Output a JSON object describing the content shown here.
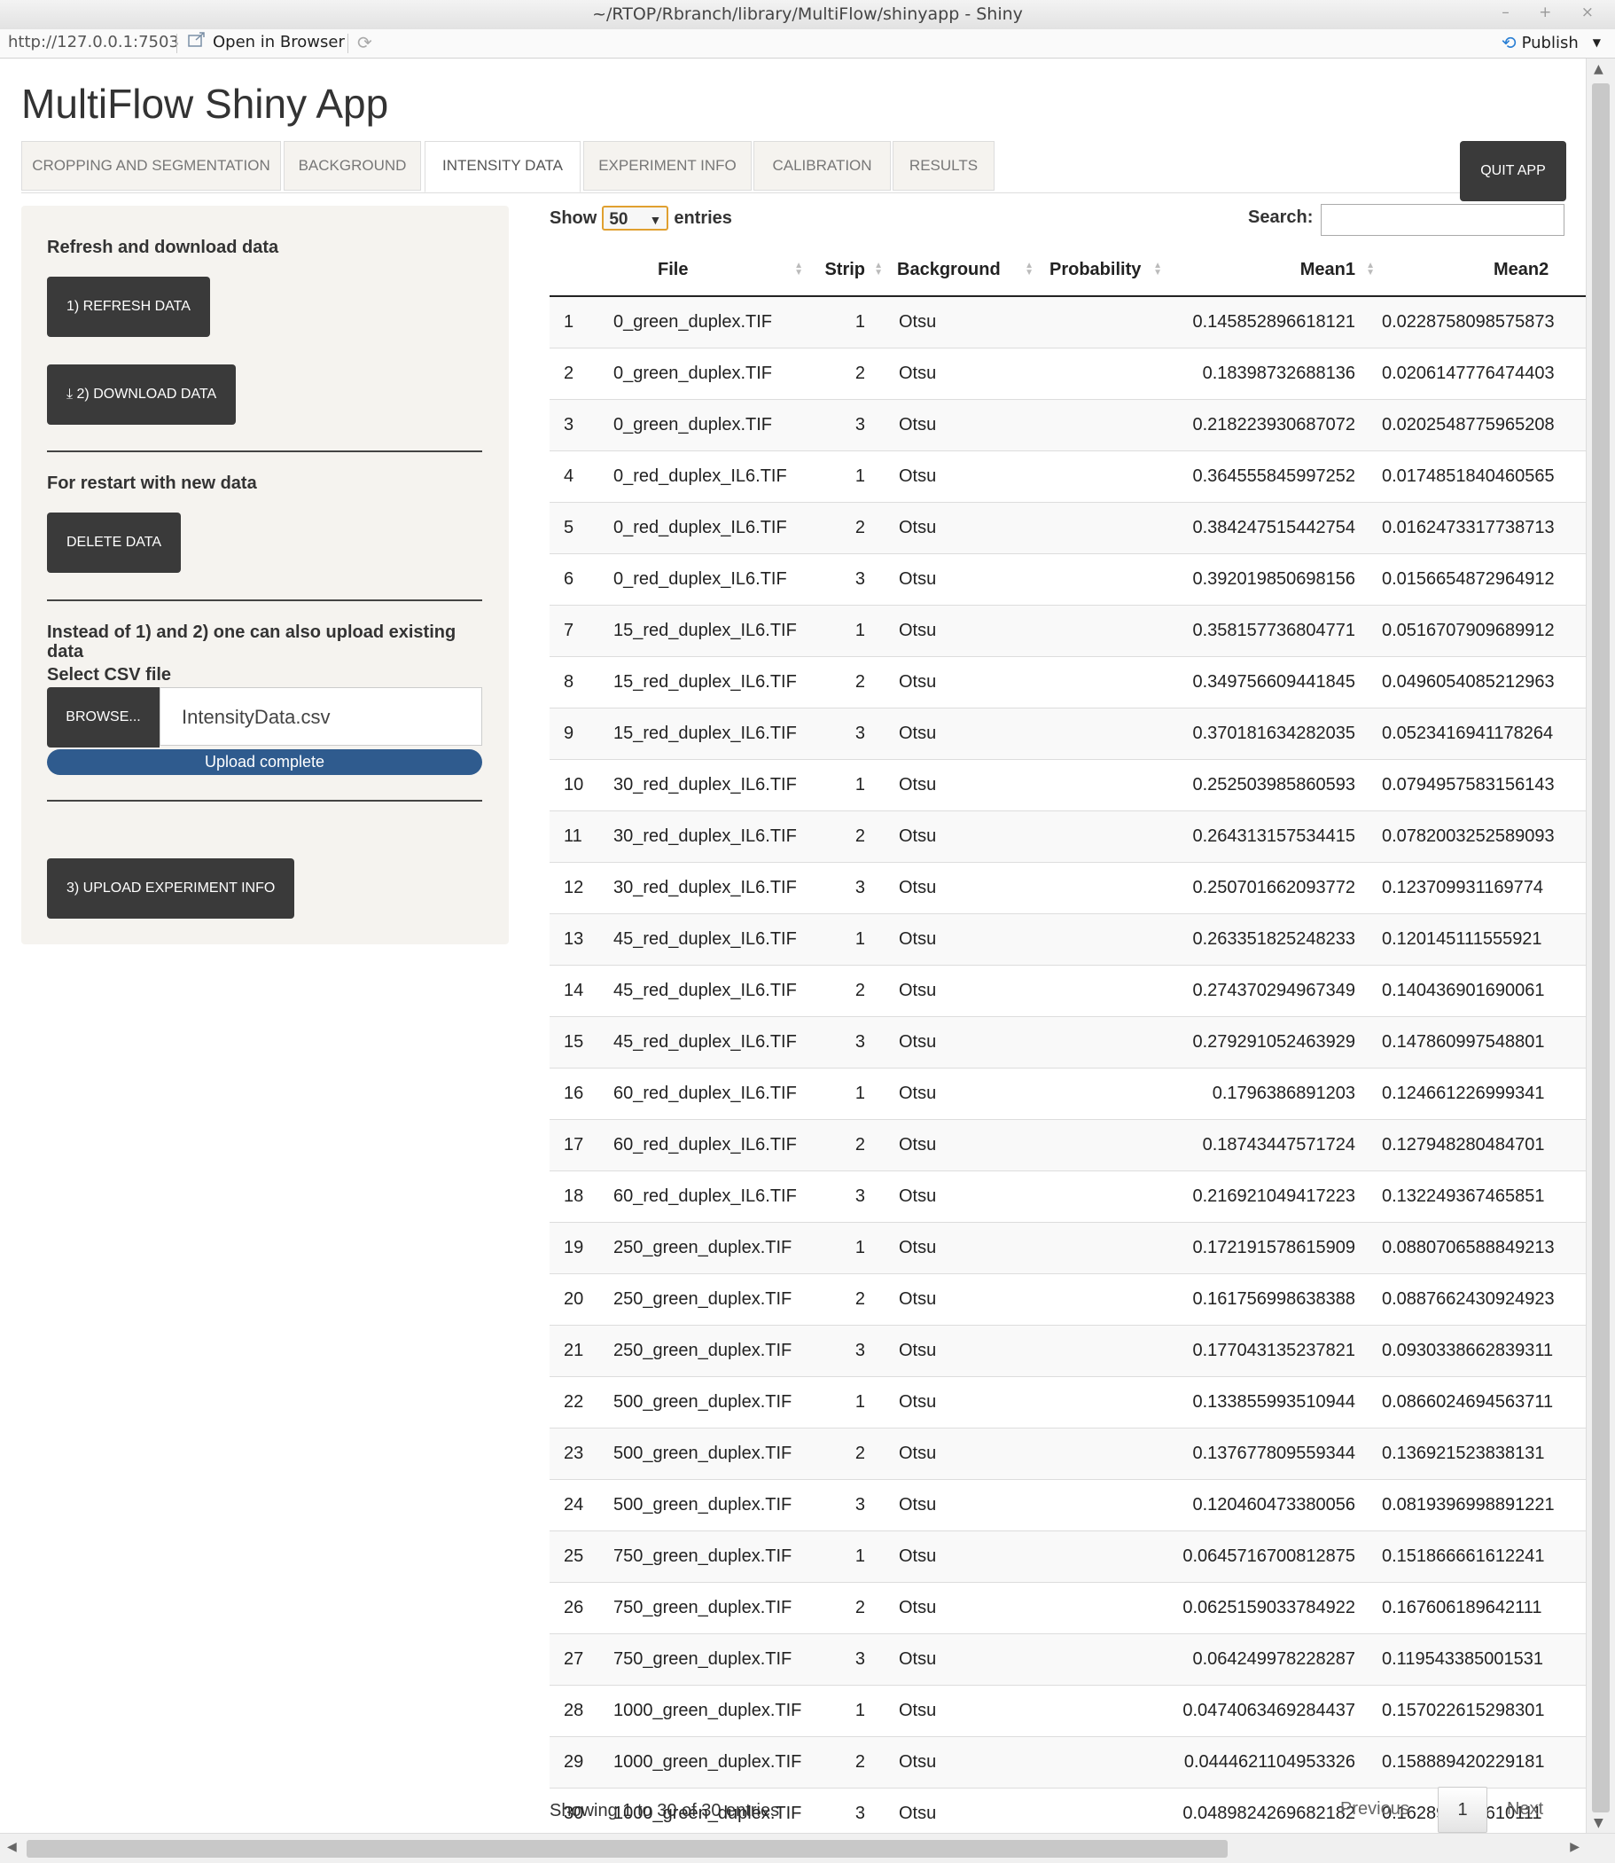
{
  "window": {
    "title": "~/RTOP/Rbranch/library/MultiFlow/shinyapp - Shiny",
    "controls": "– + ×"
  },
  "addressbar": {
    "url": "http://127.0.0.1:7503",
    "open_in_browser": "Open in Browser",
    "publish": "Publish"
  },
  "app": {
    "title": "MultiFlow Shiny App",
    "quit": "QUIT APP"
  },
  "tabs": [
    {
      "label": "CROPPING AND SEGMENTATION"
    },
    {
      "label": "BACKGROUND"
    },
    {
      "label": "INTENSITY DATA"
    },
    {
      "label": "EXPERIMENT INFO"
    },
    {
      "label": "CALIBRATION"
    },
    {
      "label": "RESULTS"
    }
  ],
  "sidebar": {
    "refresh_heading": "Refresh and download data",
    "refresh_button": "1) REFRESH DATA",
    "download_button": "2) DOWNLOAD DATA",
    "restart_heading": "For restart with new data",
    "delete_button": "DELETE DATA",
    "upload_heading": "Instead of 1) and 2) one can also upload existing data",
    "select_label": "Select CSV file",
    "browse_button": "BROWSE...",
    "file_name": "IntensityData.csv",
    "upload_status": "Upload complete",
    "upload_progress": 1.0,
    "experiment_button": "3) UPLOAD EXPERIMENT INFO"
  },
  "datatable": {
    "show_label": "Show",
    "page_length": "50",
    "entries_label": "entries",
    "search_label": "Search:",
    "search_value": "",
    "columns": [
      "",
      "File",
      "Strip",
      "Background",
      "Probability",
      "Mean1",
      "Mean2"
    ],
    "rows": [
      [
        "1",
        "0_green_duplex.TIF",
        "1",
        "Otsu",
        "",
        "0.145852896618121",
        "0.0228758098575873"
      ],
      [
        "2",
        "0_green_duplex.TIF",
        "2",
        "Otsu",
        "",
        "0.18398732688136",
        "0.0206147776474403"
      ],
      [
        "3",
        "0_green_duplex.TIF",
        "3",
        "Otsu",
        "",
        "0.218223930687072",
        "0.0202548775965208"
      ],
      [
        "4",
        "0_red_duplex_IL6.TIF",
        "1",
        "Otsu",
        "",
        "0.364555845997252",
        "0.0174851840460565"
      ],
      [
        "5",
        "0_red_duplex_IL6.TIF",
        "2",
        "Otsu",
        "",
        "0.384247515442754",
        "0.0162473317738713"
      ],
      [
        "6",
        "0_red_duplex_IL6.TIF",
        "3",
        "Otsu",
        "",
        "0.392019850698156",
        "0.0156654872964912"
      ],
      [
        "7",
        "15_red_duplex_IL6.TIF",
        "1",
        "Otsu",
        "",
        "0.358157736804771",
        "0.0516707909689912"
      ],
      [
        "8",
        "15_red_duplex_IL6.TIF",
        "2",
        "Otsu",
        "",
        "0.349756609441845",
        "0.0496054085212963"
      ],
      [
        "9",
        "15_red_duplex_IL6.TIF",
        "3",
        "Otsu",
        "",
        "0.370181634282035",
        "0.0523416941178264"
      ],
      [
        "10",
        "30_red_duplex_IL6.TIF",
        "1",
        "Otsu",
        "",
        "0.252503985860593",
        "0.0794957583156143"
      ],
      [
        "11",
        "30_red_duplex_IL6.TIF",
        "2",
        "Otsu",
        "",
        "0.264313157534415",
        "0.0782003252589093"
      ],
      [
        "12",
        "30_red_duplex_IL6.TIF",
        "3",
        "Otsu",
        "",
        "0.250701662093772",
        "0.123709931169774"
      ],
      [
        "13",
        "45_red_duplex_IL6.TIF",
        "1",
        "Otsu",
        "",
        "0.263351825248233",
        "0.120145111555921"
      ],
      [
        "14",
        "45_red_duplex_IL6.TIF",
        "2",
        "Otsu",
        "",
        "0.274370294967349",
        "0.140436901690061"
      ],
      [
        "15",
        "45_red_duplex_IL6.TIF",
        "3",
        "Otsu",
        "",
        "0.279291052463929",
        "0.147860997548801"
      ],
      [
        "16",
        "60_red_duplex_IL6.TIF",
        "1",
        "Otsu",
        "",
        "0.1796386891203",
        "0.124661226999341"
      ],
      [
        "17",
        "60_red_duplex_IL6.TIF",
        "2",
        "Otsu",
        "",
        "0.18743447571724",
        "0.127948280484701"
      ],
      [
        "18",
        "60_red_duplex_IL6.TIF",
        "3",
        "Otsu",
        "",
        "0.216921049417223",
        "0.132249367465851"
      ],
      [
        "19",
        "250_green_duplex.TIF",
        "1",
        "Otsu",
        "",
        "0.172191578615909",
        "0.0880706588849213"
      ],
      [
        "20",
        "250_green_duplex.TIF",
        "2",
        "Otsu",
        "",
        "0.161756998638388",
        "0.0887662430924923"
      ],
      [
        "21",
        "250_green_duplex.TIF",
        "3",
        "Otsu",
        "",
        "0.177043135237821",
        "0.0930338662839311"
      ],
      [
        "22",
        "500_green_duplex.TIF",
        "1",
        "Otsu",
        "",
        "0.133855993510944",
        "0.0866024694563711"
      ],
      [
        "23",
        "500_green_duplex.TIF",
        "2",
        "Otsu",
        "",
        "0.137677809559344",
        "0.136921523838131"
      ],
      [
        "24",
        "500_green_duplex.TIF",
        "3",
        "Otsu",
        "",
        "0.120460473380056",
        "0.0819396998891221"
      ],
      [
        "25",
        "750_green_duplex.TIF",
        "1",
        "Otsu",
        "",
        "0.0645716700812875",
        "0.151866661612241"
      ],
      [
        "26",
        "750_green_duplex.TIF",
        "2",
        "Otsu",
        "",
        "0.0625159033784922",
        "0.167606189642111"
      ],
      [
        "27",
        "750_green_duplex.TIF",
        "3",
        "Otsu",
        "",
        "0.064249978228287",
        "0.119543385001531"
      ],
      [
        "28",
        "1000_green_duplex.TIF",
        "1",
        "Otsu",
        "",
        "0.0474063469284437",
        "0.157022615298301"
      ],
      [
        "29",
        "1000_green_duplex.TIF",
        "2",
        "Otsu",
        "",
        "0.0444621104953326",
        "0.158889420229181"
      ],
      [
        "30",
        "1000_green_duplex.TIF",
        "3",
        "Otsu",
        "",
        "0.0489824269682182",
        "0.162891922610111"
      ]
    ],
    "info": "Showing 1 to 30 of 30 entries",
    "pagination": {
      "previous": "Previous",
      "page": "1",
      "next": "Next"
    }
  }
}
